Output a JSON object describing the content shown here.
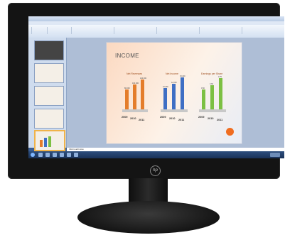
{
  "slide": {
    "title": "INCOME",
    "sections": [
      {
        "title": "Net Revenues",
        "years": [
          "2009",
          "2010",
          "2011"
        ],
        "values": [
          "80,000",
          "100,000",
          "120,000"
        ]
      },
      {
        "title": "Net Income",
        "years": [
          "2009",
          "2010",
          "2011"
        ],
        "values": [
          "10,000",
          "12,000",
          "15,000"
        ]
      },
      {
        "title": "Earnings per Share",
        "years": [
          "2009",
          "2010",
          "2011"
        ],
        "values": [
          "0.50",
          "0.60",
          "0.75"
        ]
      }
    ]
  },
  "notes_placeholder": "Click to add notes",
  "brand": "hp",
  "colors": {
    "orange": "#e47d2b",
    "blue": "#3f6fc4",
    "green": "#7cc043"
  }
}
